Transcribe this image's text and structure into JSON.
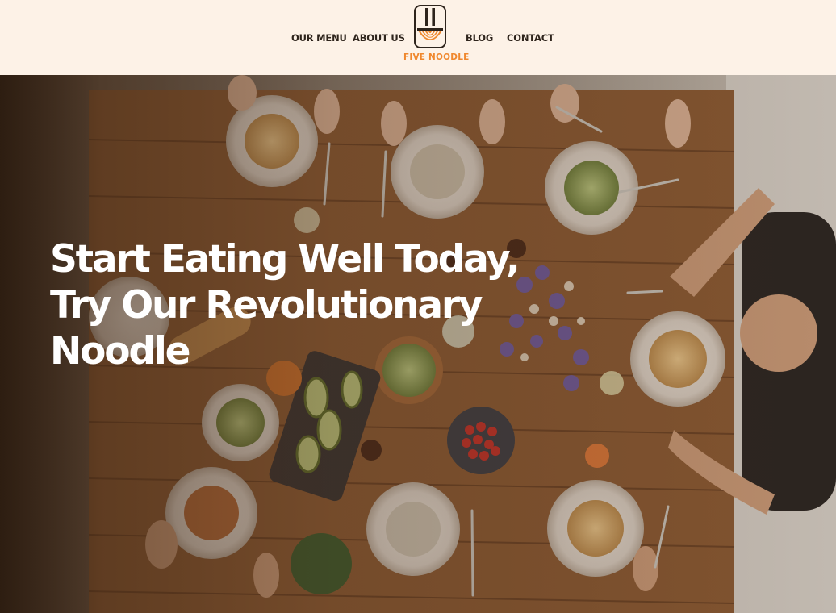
{
  "nav": {
    "left": [
      "OUR MENU",
      "ABOUT US"
    ],
    "right": [
      "BLOG",
      "CONTACT"
    ]
  },
  "logo": {
    "text": "FIVE NOODLE",
    "accent_color": "#f0882e",
    "icon": "noodle-bowl-icon"
  },
  "hero": {
    "headline_lines": [
      "Start Eating Well Today,",
      "Try Our Revolutionary",
      "Noodle"
    ],
    "background": "overhead-photo-of-dinner-table-with-noodle-dishes"
  },
  "colors": {
    "header_bg": "#fdf2e7",
    "nav_text": "#2e241c",
    "accent": "#f0882e",
    "headline": "#ffffff"
  }
}
